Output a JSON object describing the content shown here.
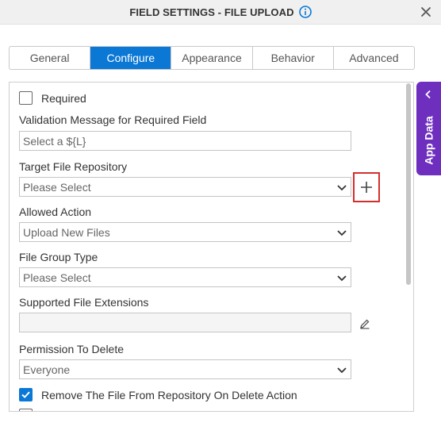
{
  "dialog": {
    "title": "FIELD SETTINGS - FILE UPLOAD"
  },
  "tabs": [
    {
      "label": "General",
      "active": false
    },
    {
      "label": "Configure",
      "active": true
    },
    {
      "label": "Appearance",
      "active": false
    },
    {
      "label": "Behavior",
      "active": false
    },
    {
      "label": "Advanced",
      "active": false
    }
  ],
  "form": {
    "required_label": "Required",
    "validation_message_label": "Validation Message for Required Field",
    "validation_message_placeholder": "Select a ${L}",
    "target_repo_label": "Target File Repository",
    "target_repo_value": "Please Select",
    "allowed_action_label": "Allowed Action",
    "allowed_action_value": "Upload New Files",
    "file_group_type_label": "File Group Type",
    "file_group_type_value": "Please Select",
    "supported_ext_label": "Supported File Extensions",
    "supported_ext_value": "",
    "permission_delete_label": "Permission To Delete",
    "permission_delete_value": "Everyone",
    "remove_file_label": "Remove The File From Repository On Delete Action"
  },
  "side_panel": {
    "label": "App Data"
  },
  "colors": {
    "accent": "#0b78d6",
    "side_panel": "#6e2fbf",
    "highlight": "#d32f2f"
  }
}
